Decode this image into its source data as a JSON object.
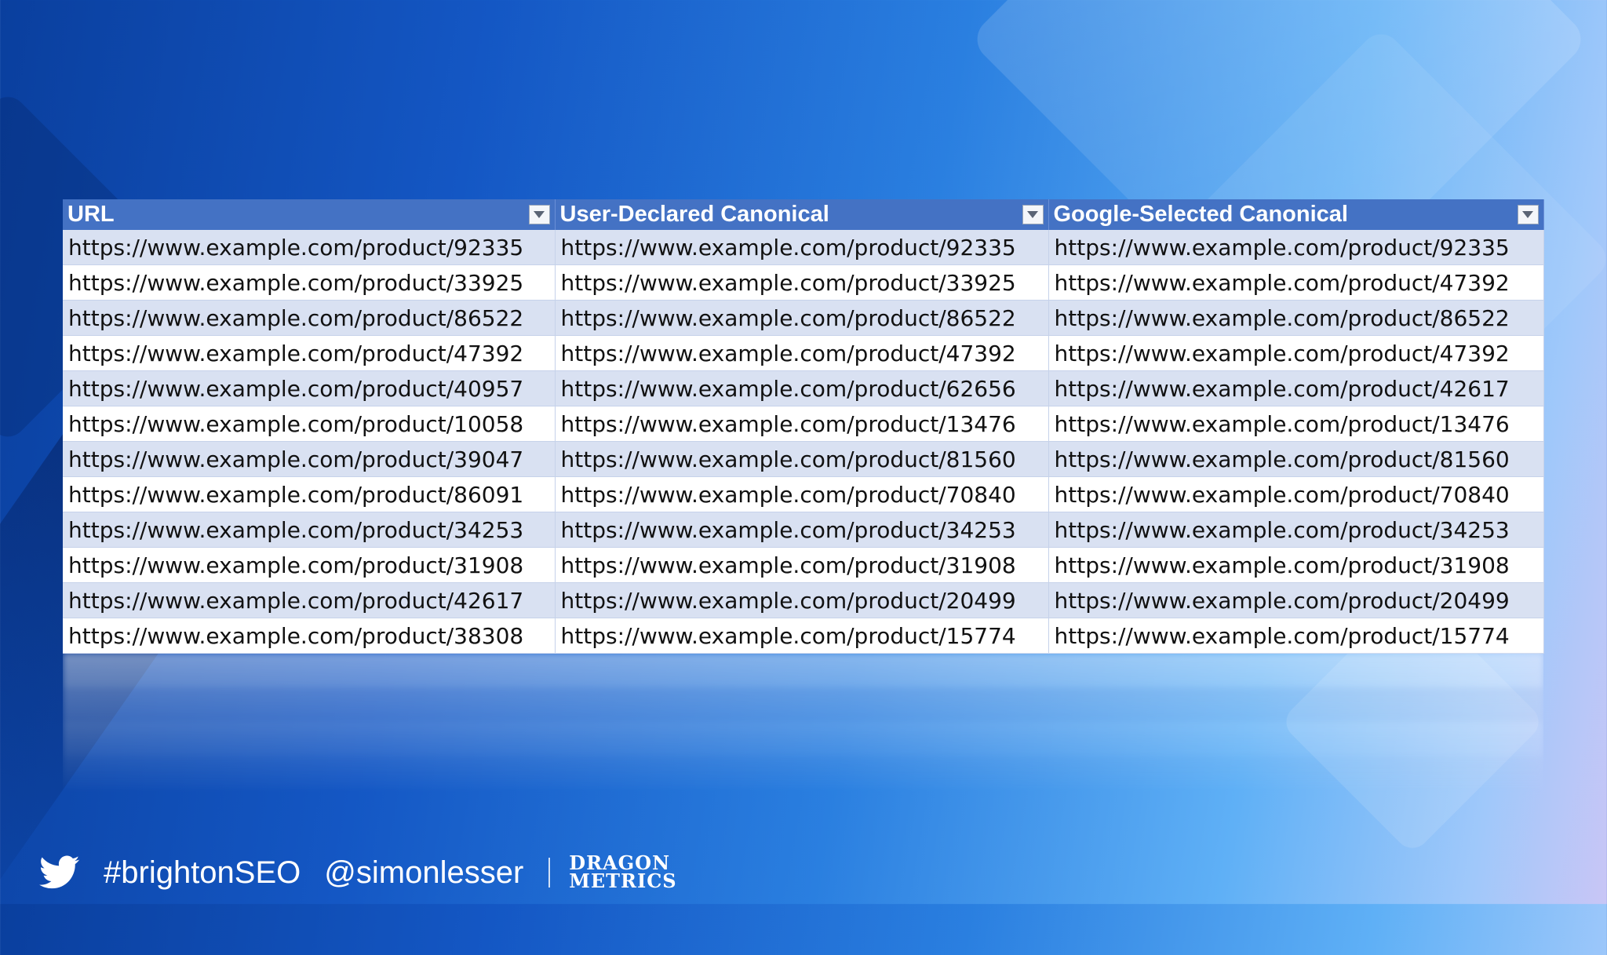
{
  "table": {
    "columns": [
      "URL",
      "User-Declared Canonical",
      "Google-Selected Canonical"
    ],
    "rows": [
      [
        "https://www.example.com/product/92335",
        "https://www.example.com/product/92335",
        "https://www.example.com/product/92335"
      ],
      [
        "https://www.example.com/product/33925",
        "https://www.example.com/product/33925",
        "https://www.example.com/product/47392"
      ],
      [
        "https://www.example.com/product/86522",
        "https://www.example.com/product/86522",
        "https://www.example.com/product/86522"
      ],
      [
        "https://www.example.com/product/47392",
        "https://www.example.com/product/47392",
        "https://www.example.com/product/47392"
      ],
      [
        "https://www.example.com/product/40957",
        "https://www.example.com/product/62656",
        "https://www.example.com/product/42617"
      ],
      [
        "https://www.example.com/product/10058",
        "https://www.example.com/product/13476",
        "https://www.example.com/product/13476"
      ],
      [
        "https://www.example.com/product/39047",
        "https://www.example.com/product/81560",
        "https://www.example.com/product/81560"
      ],
      [
        "https://www.example.com/product/86091",
        "https://www.example.com/product/70840",
        "https://www.example.com/product/70840"
      ],
      [
        "https://www.example.com/product/34253",
        "https://www.example.com/product/34253",
        "https://www.example.com/product/34253"
      ],
      [
        "https://www.example.com/product/31908",
        "https://www.example.com/product/31908",
        "https://www.example.com/product/31908"
      ],
      [
        "https://www.example.com/product/42617",
        "https://www.example.com/product/20499",
        "https://www.example.com/product/20499"
      ],
      [
        "https://www.example.com/product/38308",
        "https://www.example.com/product/15774",
        "https://www.example.com/product/15774"
      ]
    ],
    "header_color": "#4472c4",
    "band_color": "#d9e1f2",
    "filter_icon": "filter-dropdown-icon"
  },
  "footer": {
    "hashtag": "#brightonSEO",
    "handle": "@simonlesser",
    "brand_line1": "DRAGON",
    "brand_line2": "METRICS",
    "social_icon": "twitter-bird-icon"
  }
}
